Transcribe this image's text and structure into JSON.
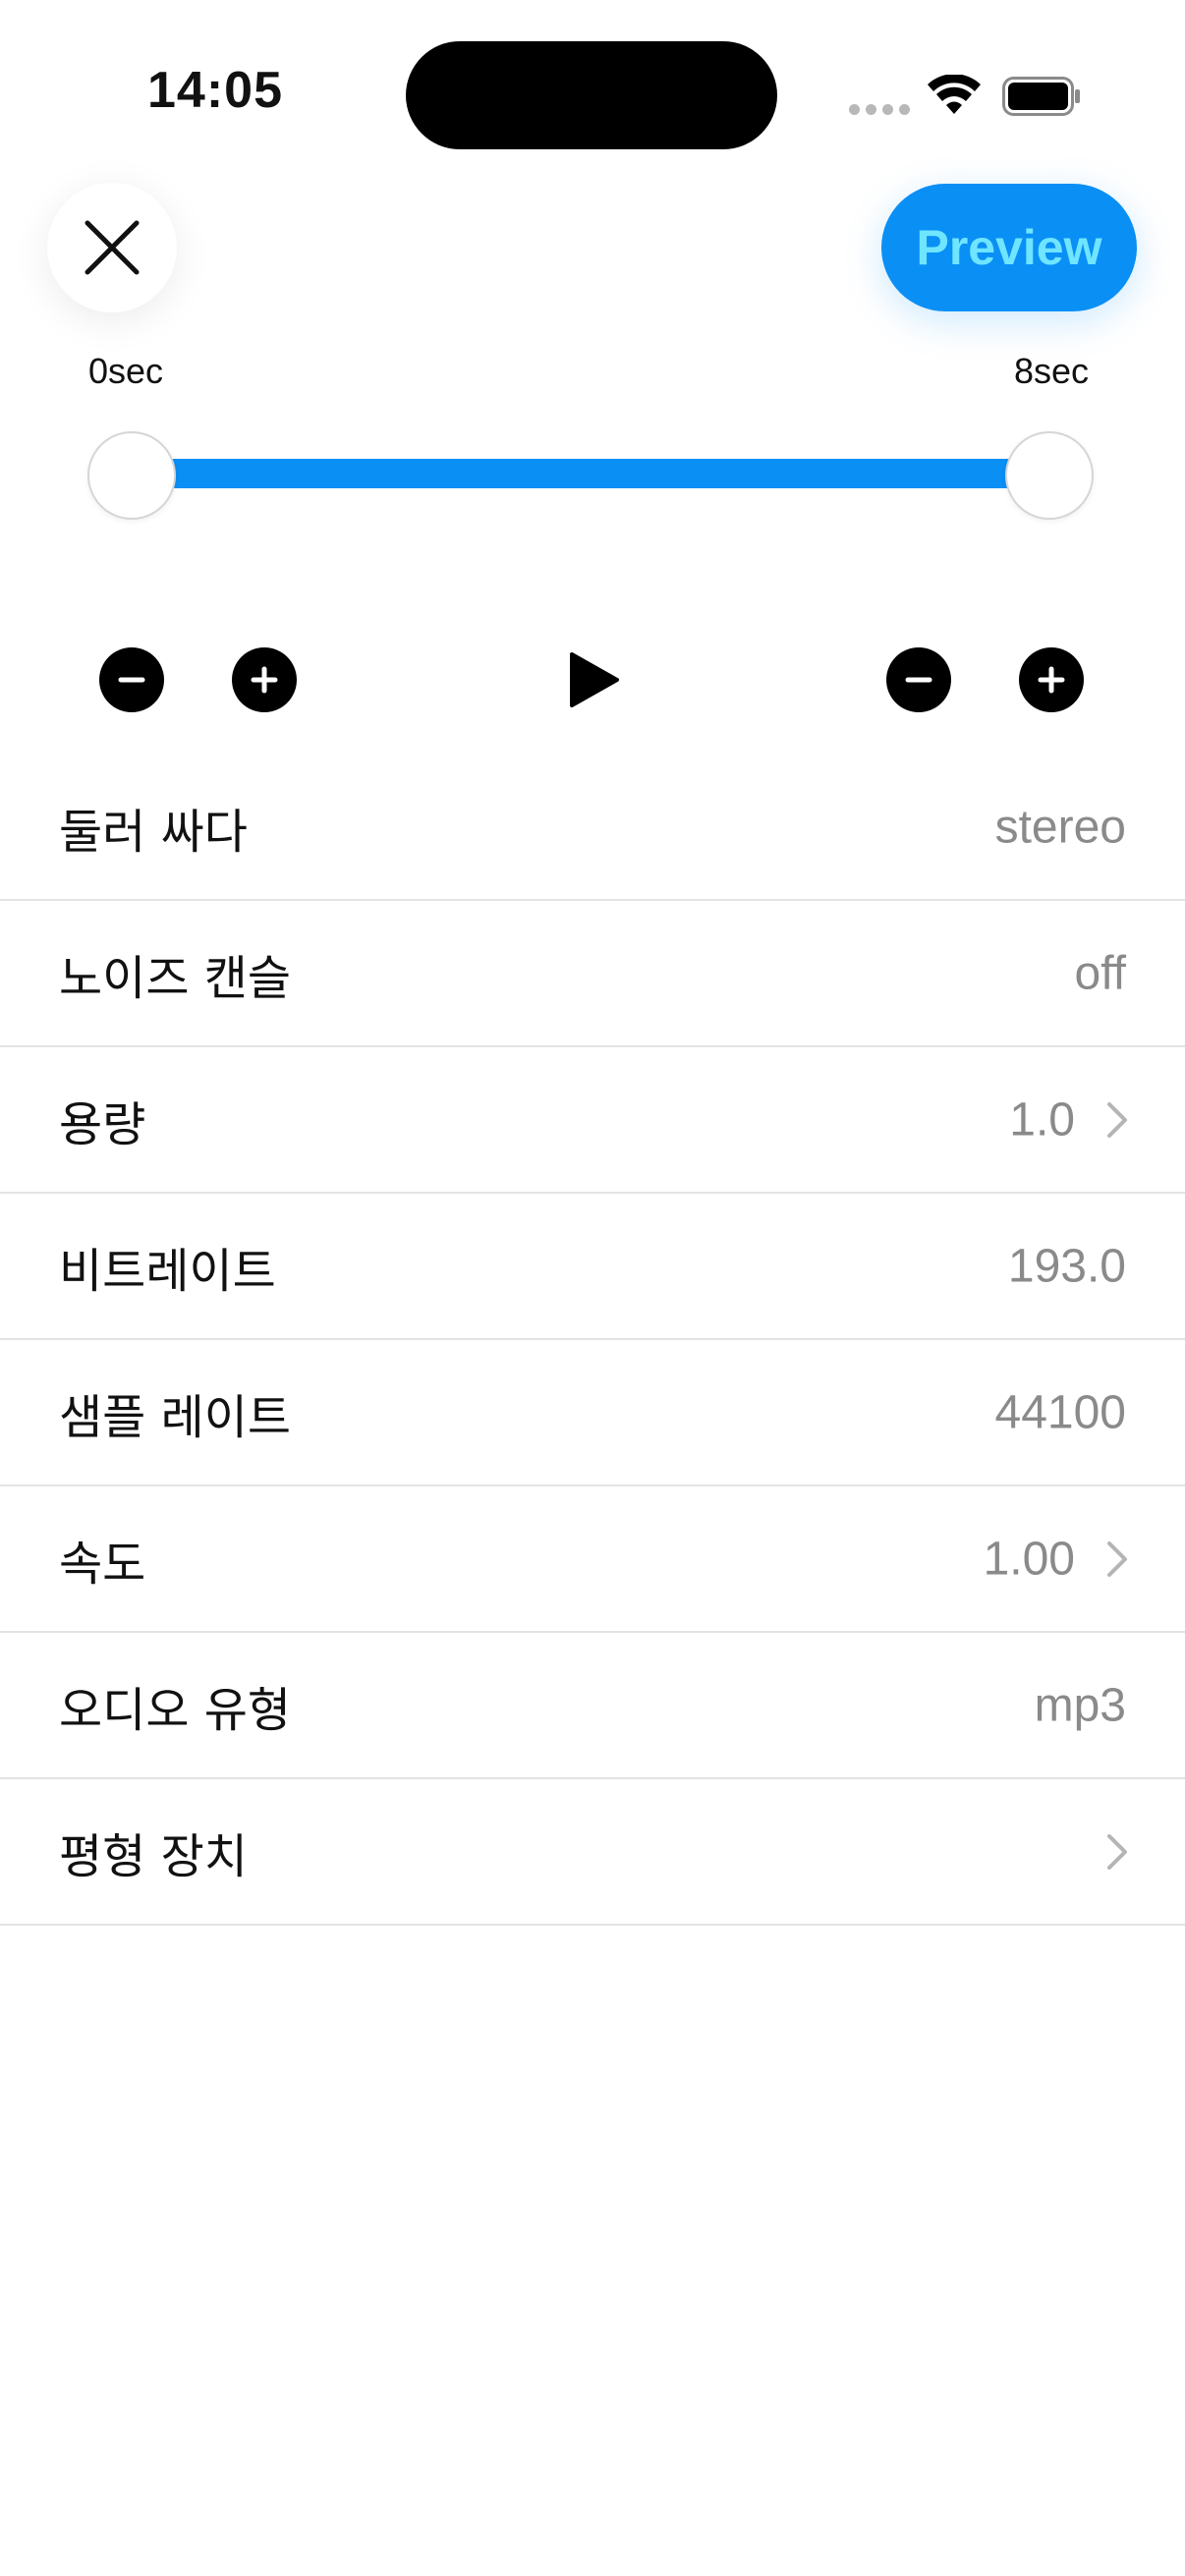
{
  "status_bar": {
    "time": "14:05"
  },
  "top_bar": {
    "close_icon": "close-icon",
    "preview_label": "Preview"
  },
  "range": {
    "start_label": "0sec",
    "end_label": "8sec",
    "start_fraction": 0.0,
    "end_fraction": 1.0
  },
  "controls": {
    "minus_icon": "minus-icon",
    "plus_icon": "plus-icon",
    "play_icon": "play-icon"
  },
  "settings": {
    "items": [
      {
        "label": "둘러 싸다",
        "value": "stereo",
        "has_chevron": false
      },
      {
        "label": "노이즈 캔슬",
        "value": "off",
        "has_chevron": false
      },
      {
        "label": "용량",
        "value": "1.0",
        "has_chevron": true
      },
      {
        "label": "비트레이트",
        "value": "193.0",
        "has_chevron": false
      },
      {
        "label": "샘플 레이트",
        "value": "44100",
        "has_chevron": false
      },
      {
        "label": "속도",
        "value": "1.00",
        "has_chevron": true
      },
      {
        "label": "오디오 유형",
        "value": "mp3",
        "has_chevron": false
      },
      {
        "label": "평형 장치",
        "value": "",
        "has_chevron": true
      }
    ]
  },
  "colors": {
    "accent": "#0a8ff5",
    "preview_text": "#6fe5ff",
    "secondary_text": "#8a8a8a",
    "divider": "#e3e3e3"
  }
}
